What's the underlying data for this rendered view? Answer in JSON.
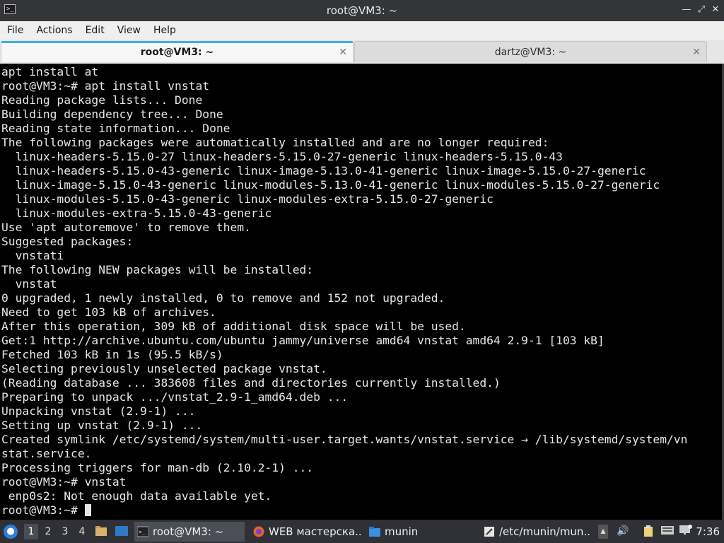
{
  "window": {
    "title": "root@VM3: ~",
    "icons": [
      "terminal-app-icon",
      "minimize-icon",
      "maximize-icon",
      "close-icon"
    ]
  },
  "menu": [
    "File",
    "Actions",
    "Edit",
    "View",
    "Help"
  ],
  "tabs": [
    {
      "label": "root@VM3: ~",
      "active": true
    },
    {
      "label": "dartz@VM3: ~",
      "active": false
    }
  ],
  "terminal": {
    "lines": [
      "apt install at",
      "root@VM3:~# apt install vnstat",
      "Reading package lists... Done",
      "Building dependency tree... Done",
      "Reading state information... Done",
      "The following packages were automatically installed and are no longer required:",
      "  linux-headers-5.15.0-27 linux-headers-5.15.0-27-generic linux-headers-5.15.0-43",
      "  linux-headers-5.15.0-43-generic linux-image-5.13.0-41-generic linux-image-5.15.0-27-generic",
      "  linux-image-5.15.0-43-generic linux-modules-5.13.0-41-generic linux-modules-5.15.0-27-generic",
      "  linux-modules-5.15.0-43-generic linux-modules-extra-5.15.0-27-generic",
      "  linux-modules-extra-5.15.0-43-generic",
      "Use 'apt autoremove' to remove them.",
      "Suggested packages:",
      "  vnstati",
      "The following NEW packages will be installed:",
      "  vnstat",
      "0 upgraded, 1 newly installed, 0 to remove and 152 not upgraded.",
      "Need to get 103 kB of archives.",
      "After this operation, 309 kB of additional disk space will be used.",
      "Get:1 http://archive.ubuntu.com/ubuntu jammy/universe amd64 vnstat amd64 2.9-1 [103 kB]",
      "Fetched 103 kB in 1s (95.5 kB/s)",
      "Selecting previously unselected package vnstat.",
      "(Reading database ... 383608 files and directories currently installed.)",
      "Preparing to unpack .../vnstat_2.9-1_amd64.deb ...",
      "Unpacking vnstat (2.9-1) ...",
      "Setting up vnstat (2.9-1) ...",
      "Created symlink /etc/systemd/system/multi-user.target.wants/vnstat.service → /lib/systemd/system/vn",
      "stat.service.",
      "Processing triggers for man-db (2.10.2-1) ...",
      "root@VM3:~# vnstat",
      " enp0s2: Not enough data available yet."
    ],
    "prompt": "root@VM3:~# "
  },
  "taskbar": {
    "workspaces": [
      "1",
      "2",
      "3",
      "4"
    ],
    "active_workspace": "1",
    "tasks": [
      {
        "label": "root@VM3: ~",
        "icon": "terminal-icon",
        "active": true
      },
      {
        "label": "WEB мастерска...",
        "icon": "firefox-icon",
        "active": false
      },
      {
        "label": "munin",
        "icon": "folder-icon",
        "active": false
      },
      {
        "label": "/etc/munin/mun...",
        "icon": "text-editor-icon",
        "active": false
      }
    ],
    "tray": [
      "volume-icon",
      "clipboard-icon",
      "keyboard-icon",
      "network-icon"
    ],
    "clock": "7:36"
  }
}
